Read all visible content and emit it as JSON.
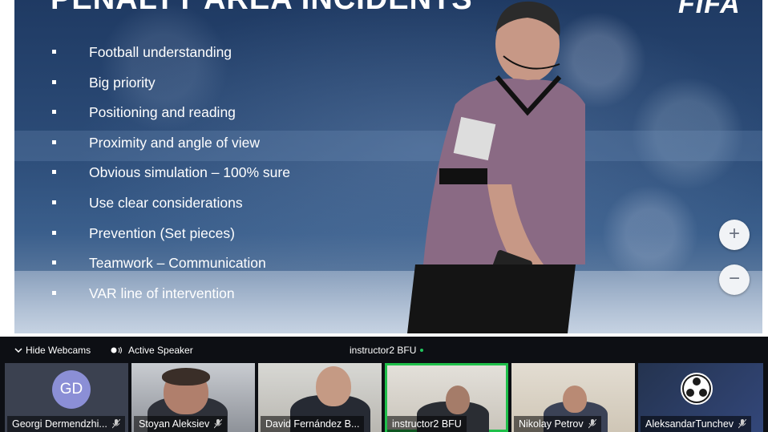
{
  "slide": {
    "title": "PENALTY AREA INCIDENTS",
    "logo_text": "FIFA",
    "bullets": [
      "Football understanding",
      "Big priority",
      "Positioning and reading",
      "Proximity and angle of view",
      "Obvious simulation – 100% sure",
      "Use clear considerations",
      "Prevention (Set pieces)",
      "Teamwork – Communication",
      "VAR line of intervention"
    ],
    "zoom_in": "+",
    "zoom_out": "−"
  },
  "cam_bar": {
    "hide_webcams": "Hide Webcams",
    "active_speaker": "Active Speaker",
    "current_speaker": "instructor2 BFU"
  },
  "participants": [
    {
      "name": "Georgi Dermendzhi...",
      "initials": "GD"
    },
    {
      "name": "Stoyan Aleksiev"
    },
    {
      "name": "David Fernández B..."
    },
    {
      "name": "instructor2 BFU"
    },
    {
      "name": "Nikolay Petrov"
    },
    {
      "name": "AleksandarTunchev"
    }
  ],
  "colors": {
    "active_tile_border": "#1fbf4a",
    "avatar_gd": "#8b8fd6"
  }
}
